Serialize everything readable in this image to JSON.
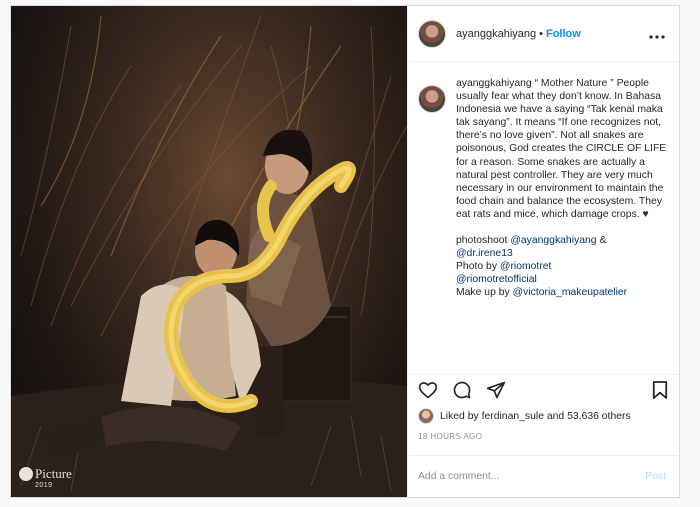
{
  "post": {
    "username": "ayanggkahiyang",
    "separator": "•",
    "follow_label": "Follow",
    "more_icon": "more-horizontal-icon",
    "photo_watermark": {
      "brand": "Picture",
      "year": "2019"
    },
    "caption": {
      "username": "ayanggkahiyang",
      "text_lines": [
        "“ Mother Nature ” People usually fear what they don’t know. In Bahasa Indonesia we have a saying “Tak kenal maka tak sayang”. It means “If one recognizes not, there’s no love given”. Not all snakes are poisonous, God creates the CIRCLE OF LIFE for a reason. Some snakes are actually a natural pest controller. They are very much necessary in our environment to maintain the food chain and balance the ecosystem. They eat rats and mice, which damage crops. ♥"
      ],
      "photoshoot_label": "photoshoot",
      "photoshoot_tag1": "@ayanggkahiyang",
      "photoshoot_amp": "&",
      "photoshoot_tag2": "@dr.irene13",
      "photo_by_label": "Photo by",
      "photo_by_tag1": "@riomotret",
      "photo_by_tag2": "@riomotretofficial",
      "makeup_label": "Make up by",
      "makeup_tag": "@victoria_makeupatelier"
    },
    "actions": {
      "like_icon": "heart-icon",
      "comment_icon": "comment-icon",
      "share_icon": "share-icon",
      "save_icon": "bookmark-icon"
    },
    "likes": {
      "prefix": "Liked by",
      "liker": "ferdinan_sule",
      "middle": "and",
      "count": "53,636 others"
    },
    "timestamp": "18 HOURS AGO",
    "comment_box": {
      "placeholder": "Add a comment...",
      "post_label": "Post"
    }
  }
}
